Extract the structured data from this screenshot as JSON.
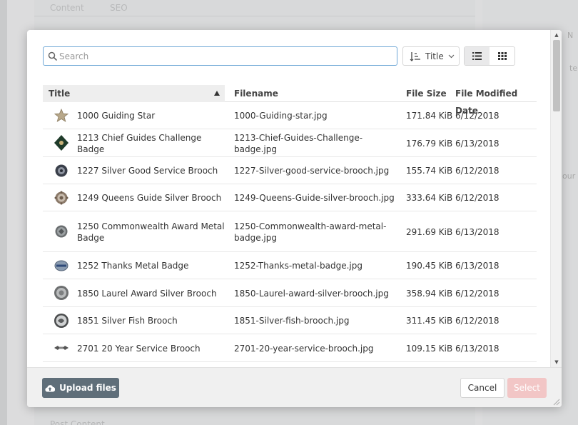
{
  "background": {
    "tabs": [
      "Content",
      "SEO"
    ],
    "bottom_label": "Post Content",
    "right_fragments": [
      "N",
      "te",
      "our"
    ]
  },
  "toolbar": {
    "search_placeholder": "Search",
    "search_value": "",
    "sort_label": "Title",
    "view_modes": [
      "list-view-icon",
      "grid-view-icon"
    ],
    "active_view": "list"
  },
  "table": {
    "columns": [
      "Title",
      "Filename",
      "File Size",
      "File Modified Date"
    ],
    "sort_column": "Title",
    "sort_direction": "ascending",
    "rows": [
      {
        "title": "1000 Guiding Star",
        "filename": "1000-Guiding-star.jpg",
        "size": "171.84 KiB",
        "date": "6/12/2018",
        "thumb": "star-thumbnail"
      },
      {
        "title": "1213 Chief Guides Challenge Badge",
        "filename": "1213-Chief-Guides-Challenge-badge.jpg",
        "size": "176.79 KiB",
        "date": "6/13/2018",
        "thumb": "diamond-badge-thumbnail"
      },
      {
        "title": "1227 Silver Good Service Brooch",
        "filename": "1227-Silver-good-service-brooch.jpg",
        "size": "155.74 KiB",
        "date": "6/12/2018",
        "thumb": "round-brooch-thumbnail"
      },
      {
        "title": "1249 Queens Guide Silver Brooch",
        "filename": "1249-Queens-Guide-silver-brooch.jpg",
        "size": "333.64 KiB",
        "date": "6/12/2018",
        "thumb": "ornate-brooch-thumbnail"
      },
      {
        "title": "1250 Commonwealth Award Metal Badge",
        "filename": "1250-Commonwealth-award-metal-badge.jpg",
        "size": "291.69 KiB",
        "date": "6/13/2018",
        "thumb": "metal-badge-thumbnail"
      },
      {
        "title": "1252 Thanks Metal Badge",
        "filename": "1252-Thanks-metal-badge.jpg",
        "size": "190.45 KiB",
        "date": "6/13/2018",
        "thumb": "thanks-badge-thumbnail"
      },
      {
        "title": "1850 Laurel Award Silver Brooch",
        "filename": "1850-Laurel-award-silver-brooch.jpg",
        "size": "358.94 KiB",
        "date": "6/12/2018",
        "thumb": "laurel-brooch-thumbnail"
      },
      {
        "title": "1851 Silver Fish Brooch",
        "filename": "1851-Silver-fish-brooch.jpg",
        "size": "311.45 KiB",
        "date": "6/12/2018",
        "thumb": "fish-brooch-thumbnail"
      },
      {
        "title": "2701 20 Year Service Brooch",
        "filename": "2701-20-year-service-brooch.jpg",
        "size": "109.15 KiB",
        "date": "6/13/2018",
        "thumb": "bar-brooch-thumbnail"
      }
    ]
  },
  "footer": {
    "upload_label": "Upload files",
    "cancel_label": "Cancel",
    "select_label": "Select"
  },
  "colors": {
    "search_border": "#6ea7d6",
    "upload_button": "#5f6e79",
    "select_button_disabled": "#f2c6c6",
    "header_highlight": "#eeeeee"
  }
}
